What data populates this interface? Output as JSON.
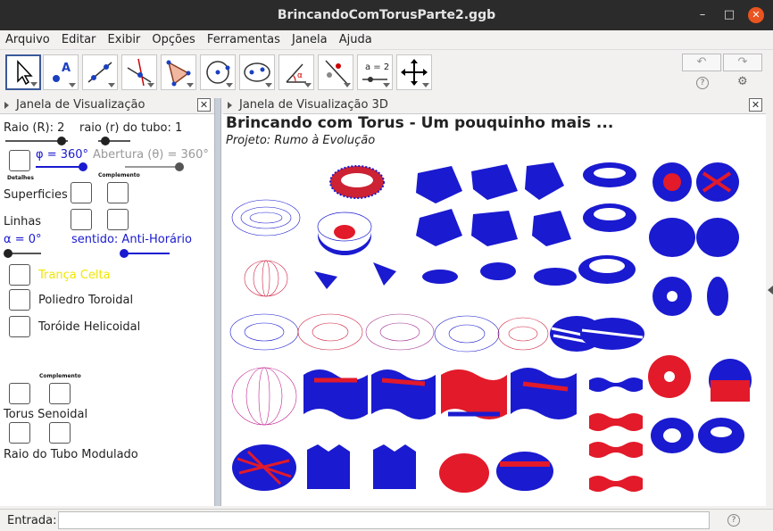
{
  "window": {
    "title": "BrincandoComTorusParte2.ggb",
    "minimize": "–",
    "maximize": "□",
    "close": "✕"
  },
  "menu": [
    "Arquivo",
    "Editar",
    "Exibir",
    "Opções",
    "Ferramentas",
    "Janela",
    "Ajuda"
  ],
  "toolbar": {
    "tools": [
      "move-tool",
      "point-tool",
      "line-tool",
      "perpendicular-tool",
      "polygon-tool",
      "circle-tool",
      "ellipse-tool",
      "angle-tool",
      "reflect-tool",
      "slider-tool",
      "move-graphics-tool"
    ],
    "slider_label": "a = 2",
    "undo": "↶",
    "redo": "↷",
    "help": "?",
    "settings": "⚙"
  },
  "left_panel": {
    "title": "Janela de Visualização",
    "raio_label": "Raio (R): 2",
    "raio_tubo_label": "raio (r) do tubo: 1",
    "phi_label": "φ = 360°",
    "abertura_label": "Abertura (θ) = 360°",
    "detalhes": "Detalhes",
    "complemento1": "Complemento",
    "superficies": "Superficies",
    "linhas": "Linhas",
    "alpha_label": "α = 0°",
    "sentido_label": "sentido: Anti-Horário",
    "tranca": "Trança Celta",
    "poliedro": "Poliedro Toroidal",
    "toroide": "Toróide Helicoidal",
    "complemento2": "Complemento",
    "torus_senoidal": "Torus Senoidal",
    "raio_modulado": "Raio do Tubo Modulado",
    "colors": {
      "blue": "#1a1ad0",
      "yellow": "#f2e600",
      "gray": "#999999"
    }
  },
  "right_panel": {
    "title": "Janela de Visualização 3D",
    "heading": "Brincando com Torus - Um pouquinho mais ...",
    "subtitle": "Projeto: Rumo à Evolução"
  },
  "entry": {
    "label": "Entrada:",
    "value": "",
    "help": "?"
  }
}
